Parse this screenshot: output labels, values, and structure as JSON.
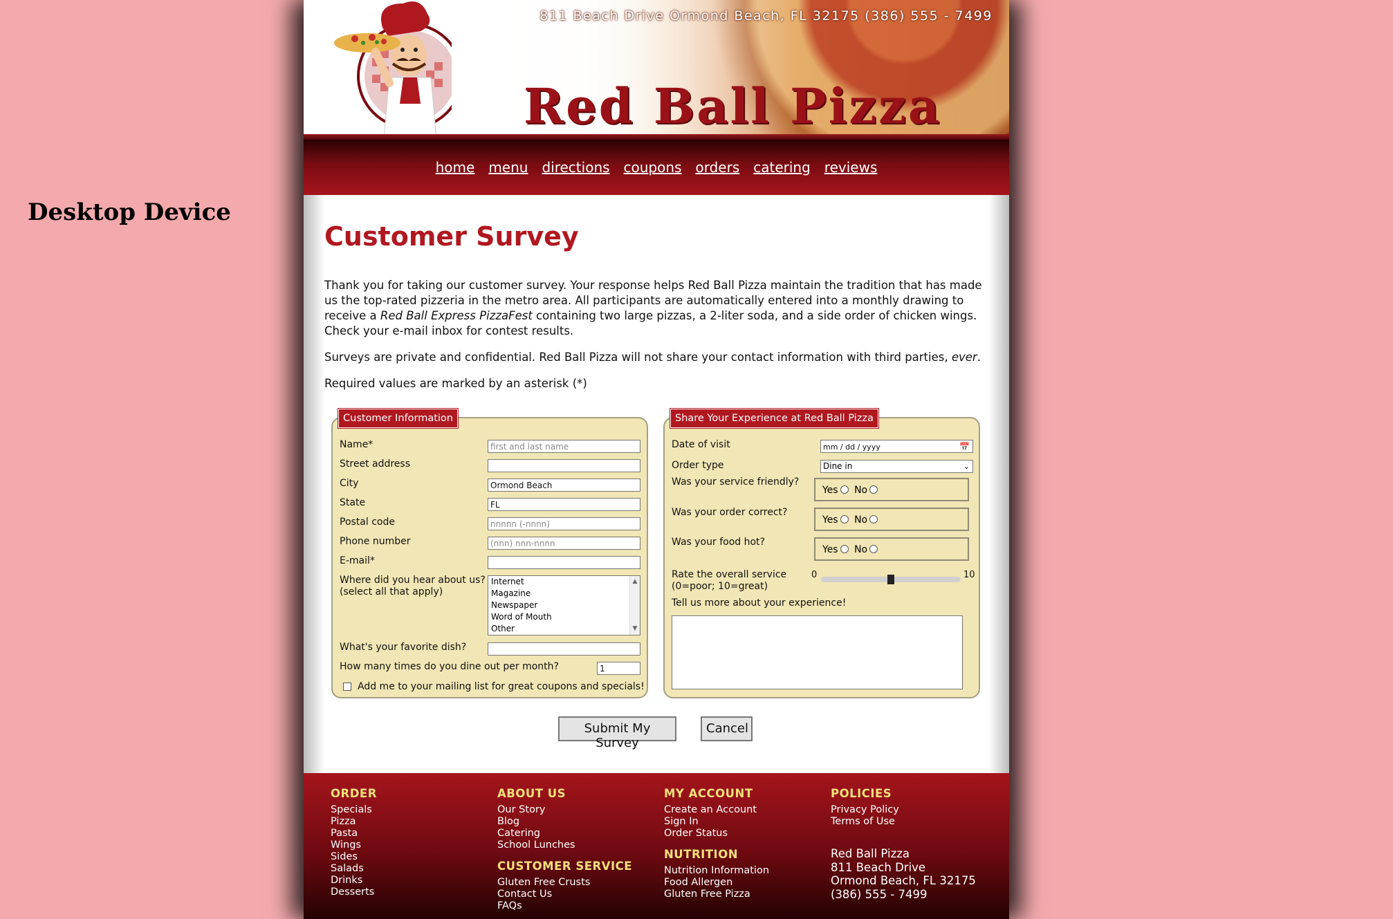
{
  "device_label": "Desktop Device",
  "header": {
    "address": "811 Beach Drive  Ormond Beach, FL 32175   (386) 555 - 7499",
    "brand": "Red Ball Pizza"
  },
  "nav": [
    "home",
    "menu",
    "directions",
    "coupons",
    "orders",
    "catering",
    "reviews"
  ],
  "page_title": "Customer Survey",
  "intro": {
    "p1_before": "Thank you for taking our customer survey. Your response helps Red Ball Pizza maintain the tradition that has made us the top-rated pizzeria in the metro area. All participants are automatically entered into a monthly drawing to receive a ",
    "p1_em": "Red Ball Express PizzaFest",
    "p1_after": " containing two large pizzas, a 2-liter soda, and a side order of chicken wings. Check your e-mail inbox for contest results.",
    "p2_before": "Surveys are private and confidential. Red Ball Pizza will not share your contact information with third parties, ",
    "p2_em": "ever",
    "p2_after": ".",
    "p3": "Required values are marked by an asterisk (*)"
  },
  "customer_info": {
    "legend": "Customer Information",
    "name_label": "Name*",
    "name_placeholder": "first and last name",
    "street_label": "Street address",
    "city_label": "City",
    "city_value": "Ormond Beach",
    "state_label": "State",
    "state_value": "FL",
    "postal_label": "Postal code",
    "postal_placeholder": "nnnnn (-nnnn)",
    "phone_label": "Phone number",
    "phone_placeholder": "(nnn) nnn-nnnn",
    "email_label": "E-mail*",
    "hear_label_1": "Where did you hear about us?",
    "hear_label_2": "(select all that apply)",
    "hear_options": [
      "Internet",
      "Magazine",
      "Newspaper",
      "Word of Mouth",
      "Other"
    ],
    "dish_label": "What's your favorite dish?",
    "dineout_label": "How many times do you dine out per month?",
    "dineout_value": "1",
    "mailing_label": "Add me to your mailing list for great coupons and specials!"
  },
  "experience": {
    "legend": "Share Your Experience at Red Ball Pizza",
    "date_label": "Date of visit",
    "date_placeholder": "mm / dd / yyyy",
    "order_label": "Order type",
    "order_value": "Dine in",
    "q_friendly": "Was your service friendly?",
    "q_correct": "Was your order correct?",
    "q_hot": "Was your food hot?",
    "yes": "Yes",
    "no": "No",
    "rate_label_1": "Rate the overall service",
    "rate_label_2": "(0=poor; 10=great)",
    "rate_min": "0",
    "rate_max": "10",
    "rate_value": 5,
    "tell_label": "Tell us more about your experience!"
  },
  "buttons": {
    "submit": "Submit My Survey",
    "cancel": "Cancel"
  },
  "footer": {
    "order": {
      "title": "ORDER",
      "links": [
        "Specials",
        "Pizza",
        "Pasta",
        "Wings",
        "Sides",
        "Salads",
        "Drinks",
        "Desserts"
      ]
    },
    "about": {
      "title": "ABOUT US",
      "links": [
        "Our Story",
        "Blog",
        "Catering",
        "School Lunches"
      ]
    },
    "service": {
      "title": "CUSTOMER SERVICE",
      "links": [
        "Gluten Free Crusts",
        "Contact Us",
        "FAQs"
      ]
    },
    "account": {
      "title": "MY ACCOUNT",
      "links": [
        "Create an Account",
        "Sign In",
        "Order Status"
      ]
    },
    "nutrition": {
      "title": "NUTRITION",
      "links": [
        "Nutrition Information",
        "Food Allergen",
        "Gluten Free Pizza"
      ]
    },
    "policies": {
      "title": "POLICIES",
      "links": [
        "Privacy Policy",
        "Terms of Use"
      ]
    },
    "address_lines": [
      "Red Ball Pizza",
      "811 Beach Drive",
      "Ormond Beach, FL 32175",
      "(386) 555 - 7499"
    ]
  }
}
